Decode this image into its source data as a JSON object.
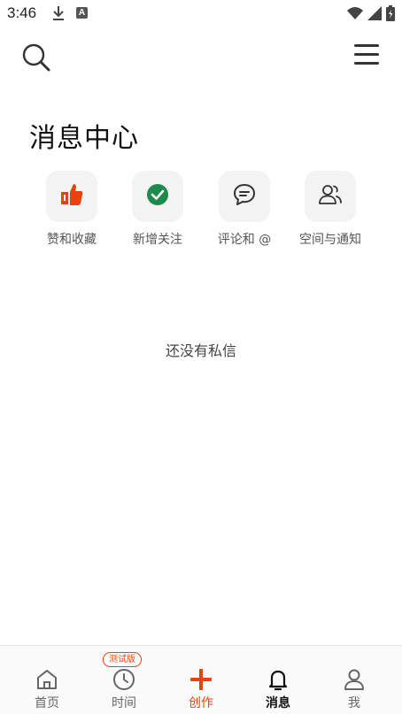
{
  "status_bar": {
    "time": "3:46",
    "a_icon": "A"
  },
  "header": {
    "title": "消息中心"
  },
  "categories": [
    {
      "label": "赞和收藏",
      "icon": "thumbs-up-icon"
    },
    {
      "label": "新增关注",
      "icon": "check-circle-icon"
    },
    {
      "label": "评论和 @",
      "icon": "comment-icon"
    },
    {
      "label": "空间与通知",
      "icon": "people-icon"
    }
  ],
  "empty_state": {
    "text": "还没有私信"
  },
  "bottom_nav": {
    "items": [
      {
        "label": "首页"
      },
      {
        "label": "时间"
      },
      {
        "label": "创作"
      },
      {
        "label": "消息"
      },
      {
        "label": "我"
      }
    ],
    "beta_badge": "测试版"
  },
  "colors": {
    "accent": "#e8430e",
    "green": "#1e8a4c"
  }
}
